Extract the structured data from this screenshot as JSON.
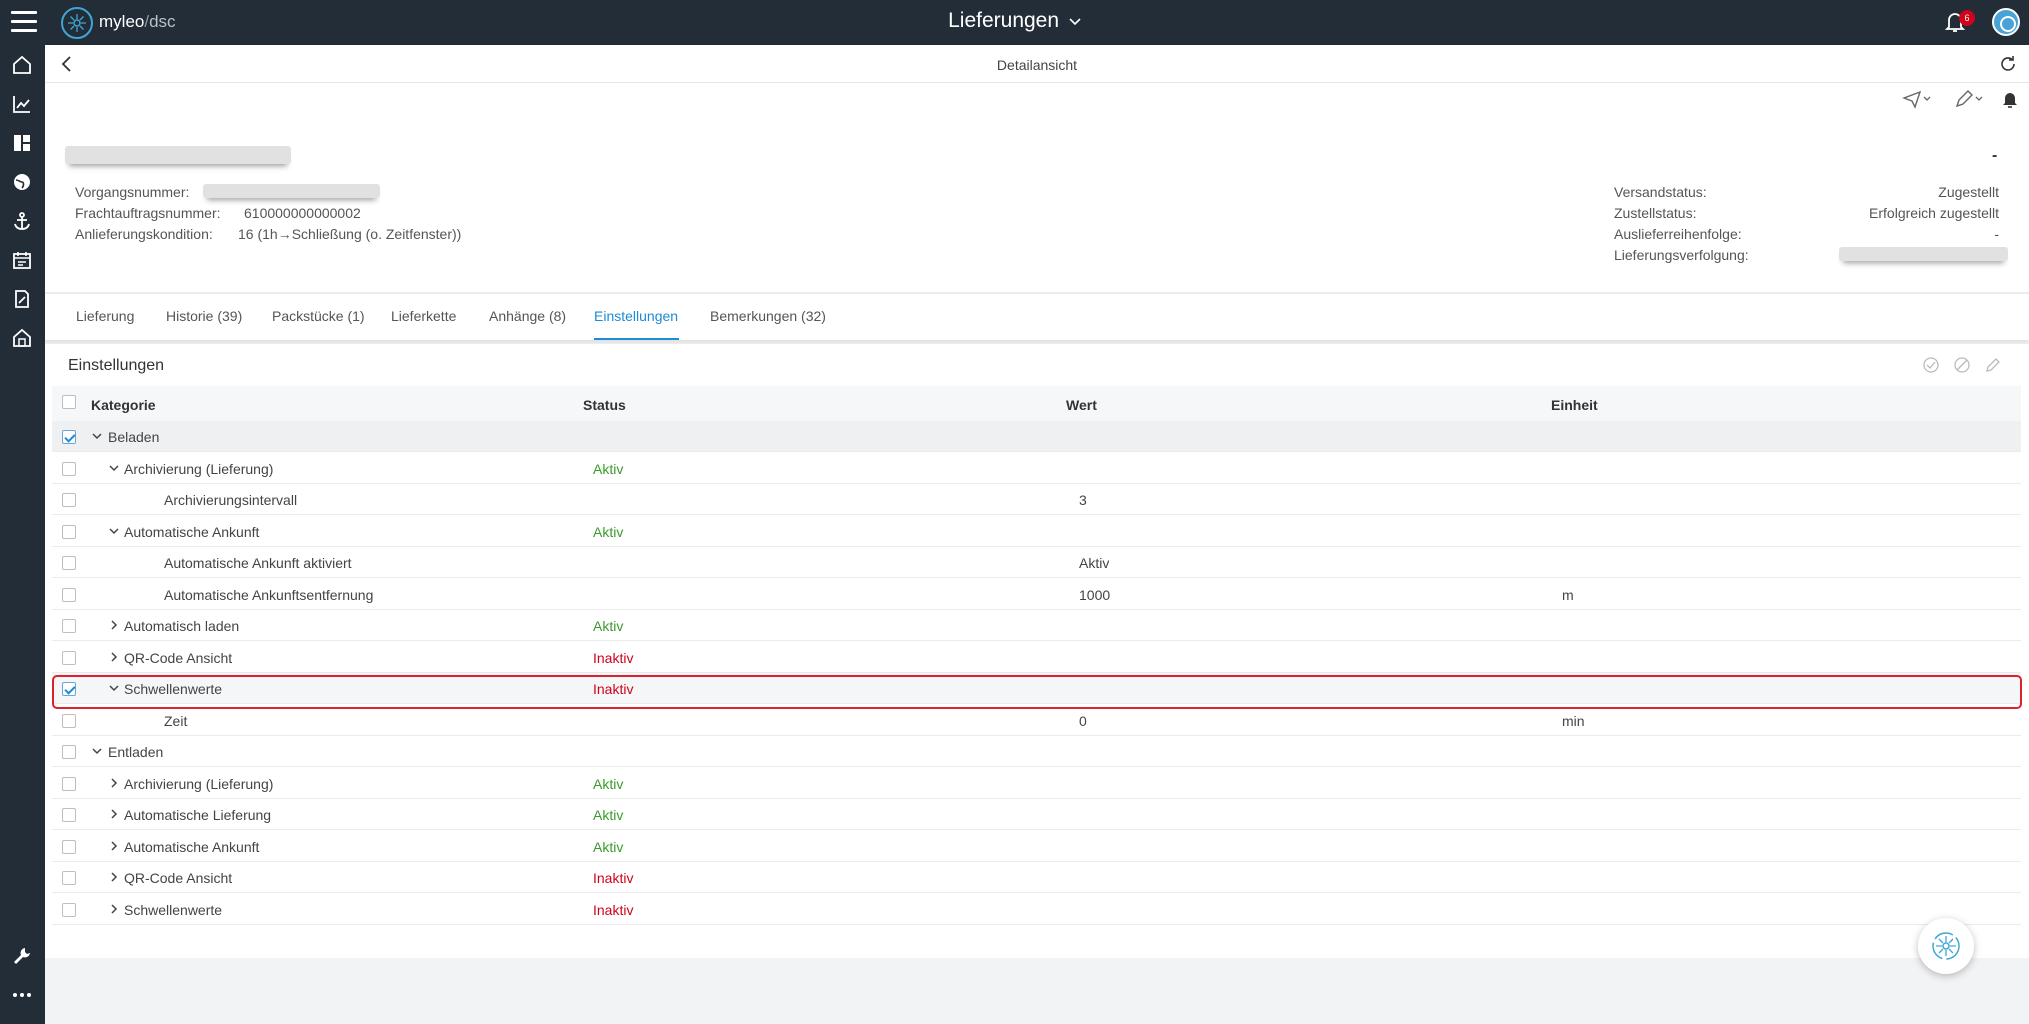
{
  "app": {
    "brand": "myleo",
    "brand_sep": "/",
    "brand_sub": "dsc",
    "title": "Lieferungen",
    "notification_count": "6"
  },
  "detail": {
    "title": "Detailansicht"
  },
  "info": {
    "dash": "-",
    "left": [
      {
        "label": "Vorgangsnummer:",
        "value": ""
      },
      {
        "label": "Frachtauftragsnummer:",
        "value": "610000000000002"
      },
      {
        "label": "Anlieferungskondition:",
        "value": "16 (1h→Schließung (o. Zeitfenster))"
      }
    ],
    "right": [
      {
        "label": "Versandstatus:",
        "value": "Zugestellt"
      },
      {
        "label": "Zustellstatus:",
        "value": "Erfolgreich zugestellt"
      },
      {
        "label": "Auslieferreihenfolge:",
        "value": "-"
      },
      {
        "label": "Lieferungsverfolgung:",
        "value": ""
      }
    ]
  },
  "tabs": [
    {
      "label": "Lieferung"
    },
    {
      "label": "Historie (39)"
    },
    {
      "label": "Packstücke (1)"
    },
    {
      "label": "Lieferkette"
    },
    {
      "label": "Anhänge (8)"
    },
    {
      "label": "Einstellungen"
    },
    {
      "label": "Bemerkungen (32)"
    }
  ],
  "settings": {
    "title": "Einstellungen",
    "columns": {
      "kategorie": "Kategorie",
      "status": "Status",
      "wert": "Wert",
      "einheit": "Einheit"
    },
    "rows": [
      {
        "kategorie": "Beladen",
        "status": "",
        "wert": "",
        "einheit": ""
      },
      {
        "kategorie": "Archivierung (Lieferung)",
        "status": "Aktiv",
        "wert": "",
        "einheit": ""
      },
      {
        "kategorie": "Archivierungsintervall",
        "status": "",
        "wert": "3",
        "einheit": ""
      },
      {
        "kategorie": "Automatische Ankunft",
        "status": "Aktiv",
        "wert": "",
        "einheit": ""
      },
      {
        "kategorie": "Automatische Ankunft aktiviert",
        "status": "",
        "wert": "Aktiv",
        "einheit": ""
      },
      {
        "kategorie": "Automatische Ankunftsentfernung",
        "status": "",
        "wert": "1000",
        "einheit": "m"
      },
      {
        "kategorie": "Automatisch laden",
        "status": "Aktiv",
        "wert": "",
        "einheit": ""
      },
      {
        "kategorie": "QR-Code Ansicht",
        "status": "Inaktiv",
        "wert": "",
        "einheit": ""
      },
      {
        "kategorie": "Schwellenwerte",
        "status": "Inaktiv",
        "wert": "",
        "einheit": ""
      },
      {
        "kategorie": "Zeit",
        "status": "",
        "wert": "0",
        "einheit": "min"
      },
      {
        "kategorie": "Entladen",
        "status": "",
        "wert": "",
        "einheit": ""
      },
      {
        "kategorie": "Archivierung (Lieferung)",
        "status": "Aktiv",
        "wert": "",
        "einheit": ""
      },
      {
        "kategorie": "Automatische Lieferung",
        "status": "Aktiv",
        "wert": "",
        "einheit": ""
      },
      {
        "kategorie": "Automatische Ankunft",
        "status": "Aktiv",
        "wert": "",
        "einheit": ""
      },
      {
        "kategorie": "QR-Code Ansicht",
        "status": "Inaktiv",
        "wert": "",
        "einheit": ""
      },
      {
        "kategorie": "Schwellenwerte",
        "status": "Inaktiv",
        "wert": "",
        "einheit": ""
      }
    ]
  },
  "colors": {
    "topbar": "#222d38",
    "accent": "#1f8ad6",
    "aktiv": "#3a9a2c",
    "inaktiv": "#d0021b",
    "highlight": "#e0202a"
  }
}
